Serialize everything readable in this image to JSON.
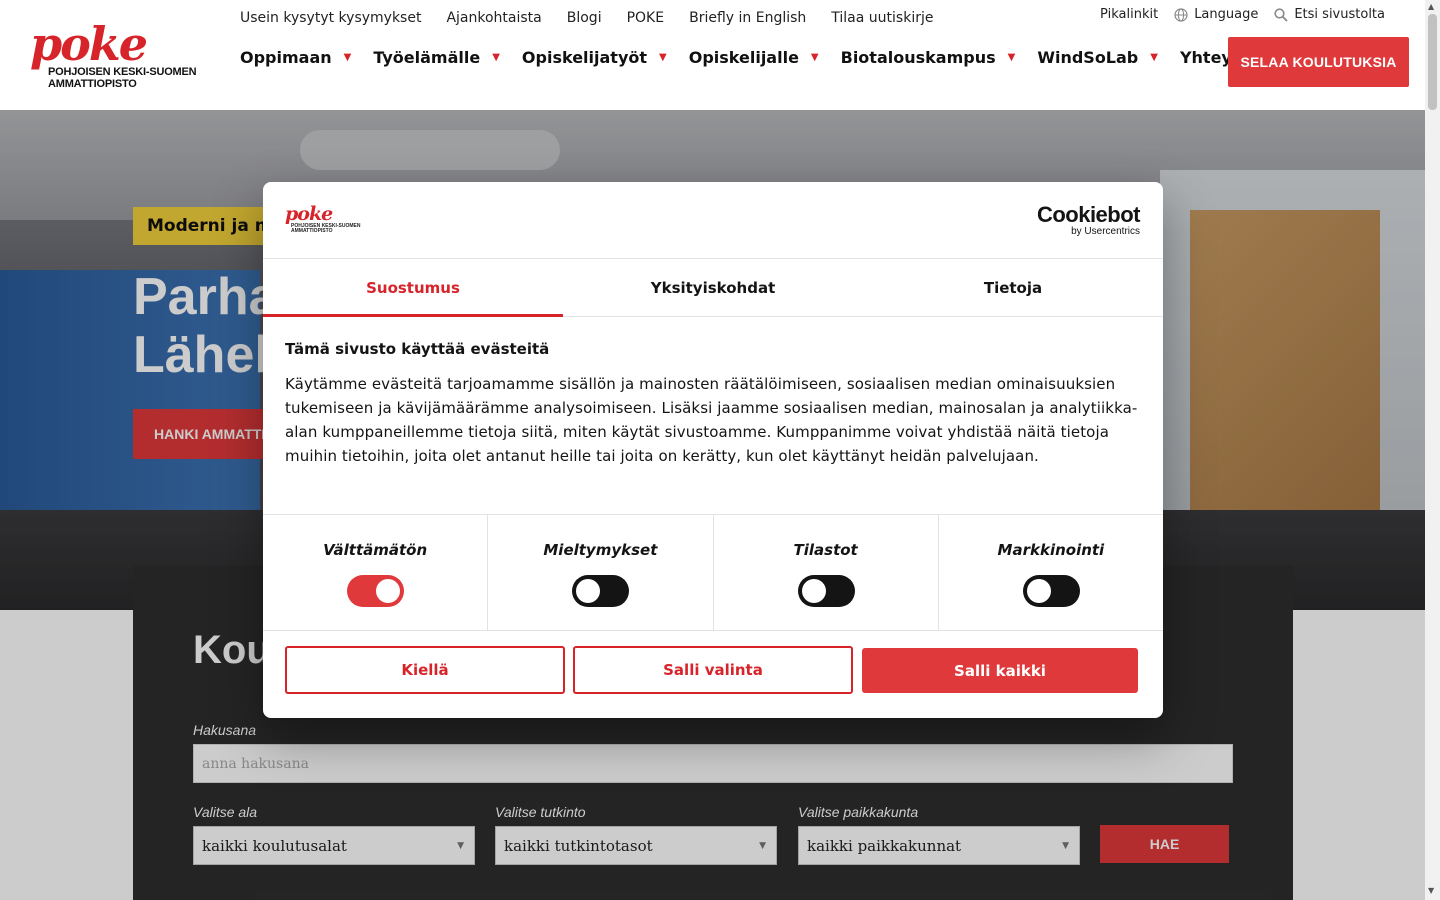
{
  "logo": {
    "word": "poke",
    "line1": "POHJOISEN KESKI-SUOMEN",
    "line2": "AMMATTIOPISTO"
  },
  "toplinks": [
    "Usein kysytyt kysymykset",
    "Ajankohtaista",
    "Blogi",
    "POKE",
    "Briefly in English",
    "Tilaa uutiskirje"
  ],
  "utility": {
    "quicklinks": "Pikalinkit",
    "language": "Language",
    "search": "Etsi sivustolta"
  },
  "nav": [
    "Oppimaan",
    "Työelämälle",
    "Opiskelijatyöt",
    "Opiskelijalle",
    "Biotalouskampus",
    "WindSoLab",
    "Yhteystiedot"
  ],
  "cta": "SELAA KOULUTUKSIA",
  "hero": {
    "badge": "Moderni ja mo",
    "title_line1": "Parha",
    "title_line2": "Lähell",
    "button": "HANKI AMMATTI"
  },
  "search": {
    "title": "Kou",
    "keyword_label": "Hakusana",
    "keyword_placeholder": "anna hakusana",
    "field_label": "Valitse ala",
    "field_value": "kaikki koulutusalat",
    "degree_label": "Valitse tutkinto",
    "degree_value": "kaikki tutkintotasot",
    "place_label": "Valitse paikkakunta",
    "place_value": "kaikki paikkakunnat",
    "submit": "HAE"
  },
  "cookie": {
    "brand_big": "Cookiebot",
    "brand_small": "by Usercentrics",
    "tabs": [
      "Suostumus",
      "Yksityiskohdat",
      "Tietoja"
    ],
    "heading": "Tämä sivusto käyttää evästeitä",
    "body": "Käytämme evästeitä tarjoamamme sisällön ja mainosten räätälöimiseen, sosiaalisen median ominaisuuksien tukemiseen ja kävijämäärämme analysoimiseen. Lisäksi jaamme sosiaalisen median, mainosalan ja analytiikka-alan kumppaneillemme tietoja siitä, miten käytät sivustoamme. Kumppanimme voivat yhdistää näitä tietoja muihin tietoihin, joita olet antanut heille tai joita on kerätty, kun olet käyttänyt heidän palvelujaan.",
    "categories": [
      "Välttämätön",
      "Mieltymykset",
      "Tilastot",
      "Markkinointi"
    ],
    "toggles": [
      true,
      false,
      false,
      false
    ],
    "deny": "Kiellä",
    "allow_selection": "Salli valinta",
    "allow_all": "Salli kaikki"
  },
  "colors": {
    "brand_red": "#e0393b",
    "badge_yellow": "#f2d03b",
    "panel_dark": "#2e2e2e"
  }
}
